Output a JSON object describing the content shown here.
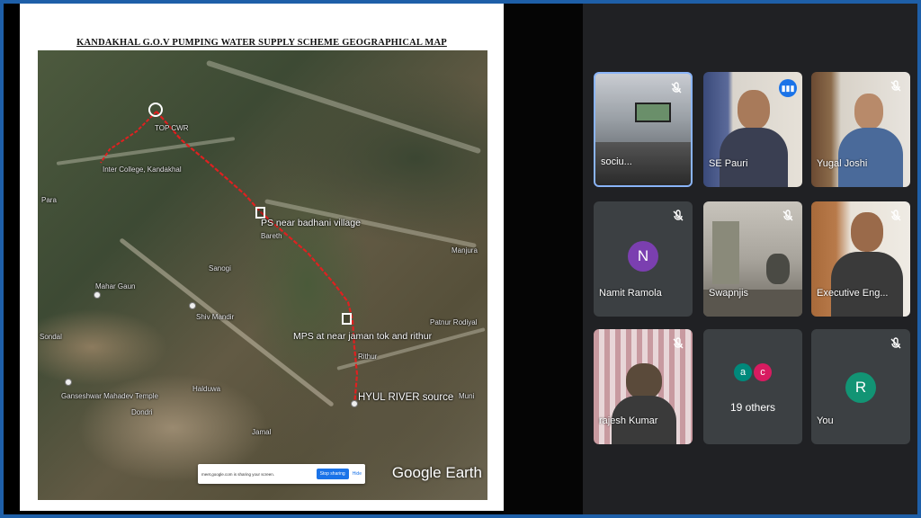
{
  "map": {
    "title": "KANDAKHAL G.O.V PUMPING WATER SUPPLY SCHEME GEOGRAPHICAL MAP",
    "labels": {
      "top_cwr": "TOP CWR",
      "inter_college": "Inter College, Kandakhal",
      "ps_badhani": "PS near badhani village",
      "bareth": "Bareth",
      "mahar_gaun": "Mahar Gaun",
      "sanogi": "Sanogi",
      "shiv_mandir": "Shiv Mandir",
      "sondal": "Sondal",
      "mps": "MPS at near jaman tok and rithur",
      "rithur": "Rithur",
      "patnur_rodiyal": "Patnur Rodiyal",
      "hyul_river": "HYUL RIVER source",
      "muni": "Muni",
      "ganseshwar": "Ganseshwar Mahadev Temple",
      "halduwa": "Halduwa",
      "dondri": "Dondri",
      "jamal": "Jamal",
      "para": "Para",
      "manjura": "Manjura"
    },
    "watermark": "Google Earth",
    "share_bar": {
      "text": "meet.google.com is sharing your screen.",
      "stop_label": "Stop sharing",
      "hide_label": "Hide"
    }
  },
  "participants": [
    {
      "name": "sociu...",
      "muted": true,
      "type": "video"
    },
    {
      "name": "SE Pauri",
      "muted": false,
      "speaking": true,
      "type": "video"
    },
    {
      "name": "Yugal Joshi",
      "muted": true,
      "type": "video"
    },
    {
      "name": "Namit Ramola",
      "muted": true,
      "type": "avatar",
      "initial": "N",
      "color": "#7b3fb0"
    },
    {
      "name": "Swapnjis",
      "muted": true,
      "type": "video"
    },
    {
      "name": "Executive Eng...",
      "muted": true,
      "type": "video"
    },
    {
      "name": "rajesh Kumar",
      "muted": true,
      "type": "video"
    },
    {
      "name": "19 others",
      "type": "others",
      "initials": [
        "a",
        "c"
      ],
      "colors": [
        "#00897b",
        "#d81b60"
      ]
    },
    {
      "name": "You",
      "muted": true,
      "type": "avatar",
      "initial": "R",
      "color": "#129474"
    }
  ]
}
